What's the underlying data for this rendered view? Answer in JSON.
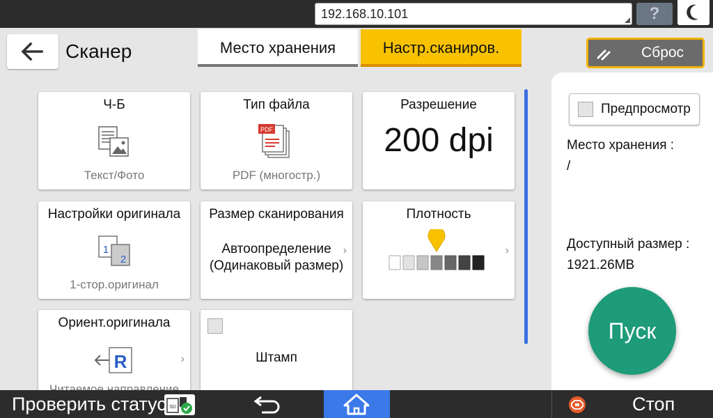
{
  "topbar": {
    "address": "192.168.10.101",
    "help_label": "?"
  },
  "header": {
    "title": "Сканер",
    "tabs": [
      {
        "label": "Место хранения",
        "active": false
      },
      {
        "label": "Настр.сканиров.",
        "active": true
      }
    ],
    "reset_label": "Сброс"
  },
  "tiles": {
    "color": {
      "title": "Ч-Б",
      "value": "Текст/Фото",
      "icon": "text-photo-icon"
    },
    "file_type": {
      "title": "Тип файла",
      "value": "PDF (многостр.)",
      "icon": "pdf-multipage-icon",
      "icon_text": "PDF"
    },
    "resolution": {
      "title": "Разрешение",
      "value": "200 dpi"
    },
    "original_settings": {
      "title": "Настройки оригинала",
      "value": "1-стор.оригинал",
      "icon": "one-sided-original-icon",
      "icon_num1": "1",
      "icon_num2": "2"
    },
    "scan_size": {
      "title": "Размер сканирования",
      "value_line1": "Автоопределение",
      "value_line2": "(Одинаковый размер)"
    },
    "density": {
      "title": "Плотность",
      "levels": 7,
      "selected_level": 4
    },
    "orientation": {
      "title": "Ориент.оригинала",
      "value": "Читаемое направление",
      "icon": "orientation-r-icon",
      "icon_letter": "R"
    },
    "stamp": {
      "title": "Штамп",
      "checked": false
    }
  },
  "right_panel": {
    "preview_label": "Предпросмотр",
    "preview_checked": false,
    "storage_label": "Место хранения :",
    "storage_value": "/",
    "available_label": "Доступный размер :",
    "available_value": "1921.26MB",
    "start_label": "Пуск"
  },
  "bottombar": {
    "status_label": "Проверить статус",
    "stop_label": "Стоп"
  },
  "colors": {
    "accent_yellow": "#f8c200",
    "start_green": "#1e9b78",
    "home_blue": "#3b78e8",
    "bar_dark": "#2c2c2c"
  }
}
